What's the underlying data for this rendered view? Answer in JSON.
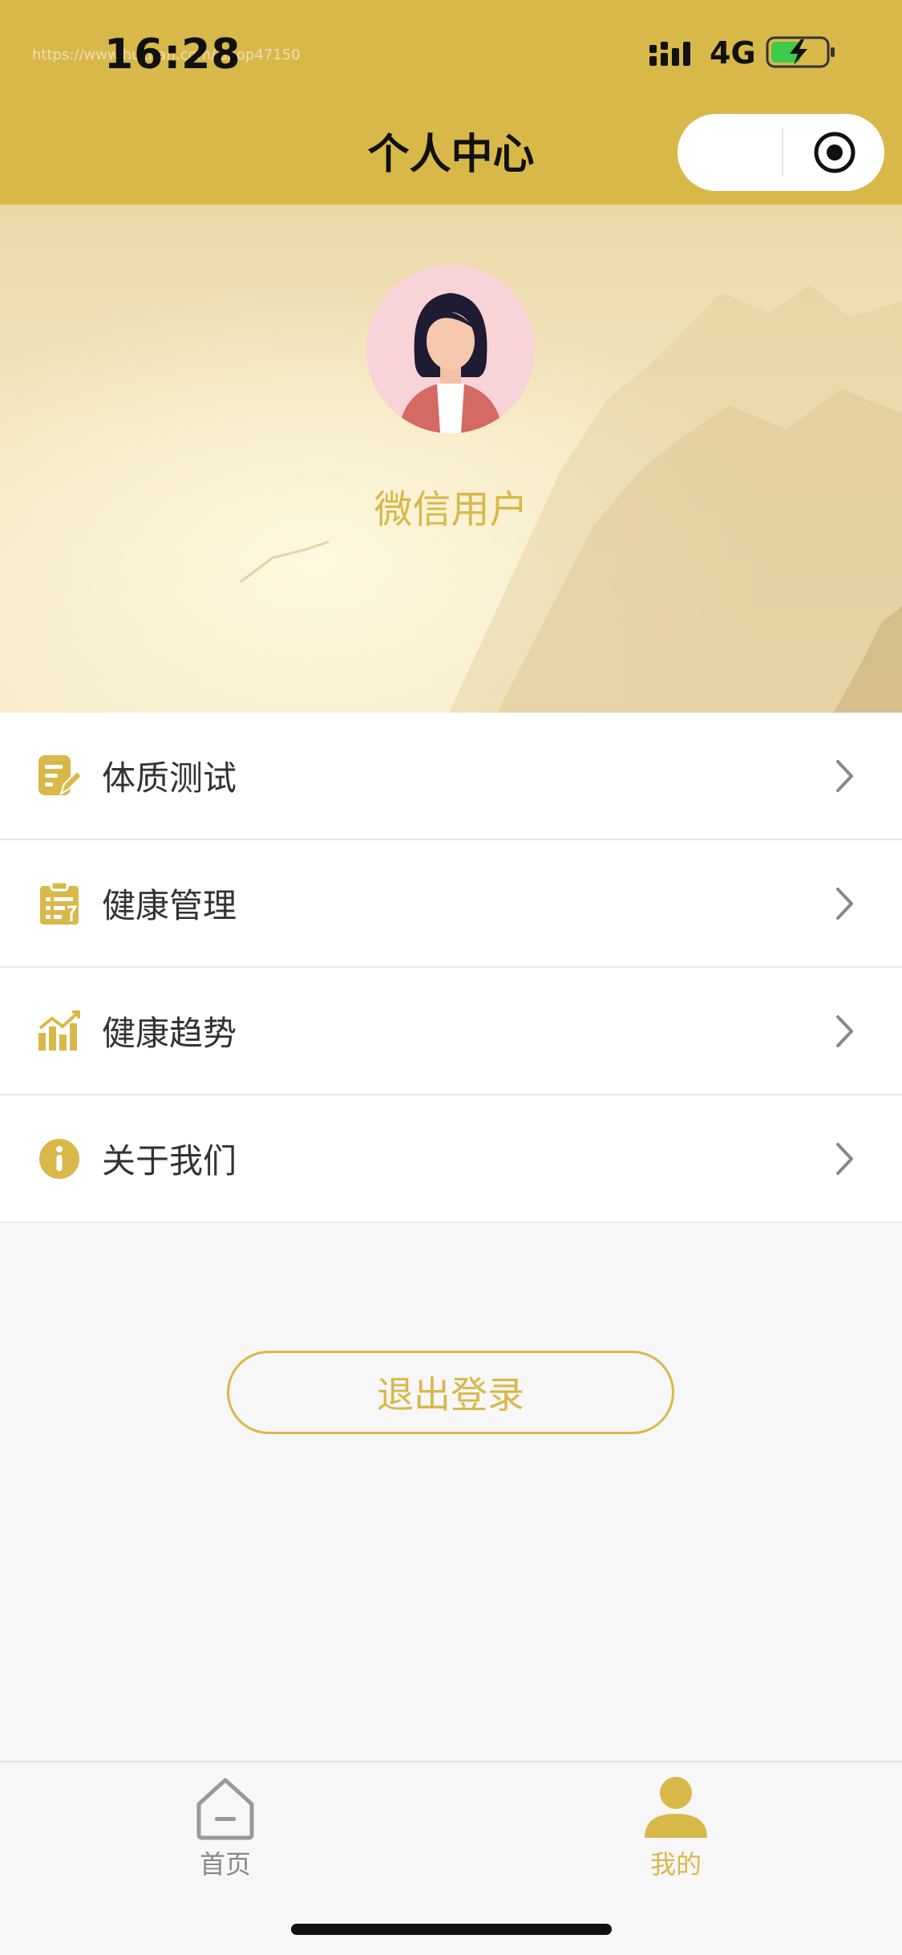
{
  "status_bar": {
    "time": "16:28",
    "network": "4G",
    "watermark": "https://www.huzhan.com/ishop47150"
  },
  "nav": {
    "title": "个人中心"
  },
  "profile": {
    "username": "微信用户"
  },
  "menu": {
    "items": [
      {
        "label": "体质测试",
        "icon": "edit-note-icon"
      },
      {
        "label": "健康管理",
        "icon": "clipboard-list-icon"
      },
      {
        "label": "健康趋势",
        "icon": "bar-chart-icon"
      },
      {
        "label": "关于我们",
        "icon": "info-icon"
      }
    ]
  },
  "logout": {
    "label": "退出登录"
  },
  "tabbar": {
    "items": [
      {
        "label": "首页",
        "icon": "home-icon"
      },
      {
        "label": "我的",
        "icon": "user-icon"
      }
    ]
  },
  "colors": {
    "accent": "#d9b84a",
    "nav_bg": "#d9b84a",
    "text": "#333333",
    "background": "#f7f7f7"
  }
}
